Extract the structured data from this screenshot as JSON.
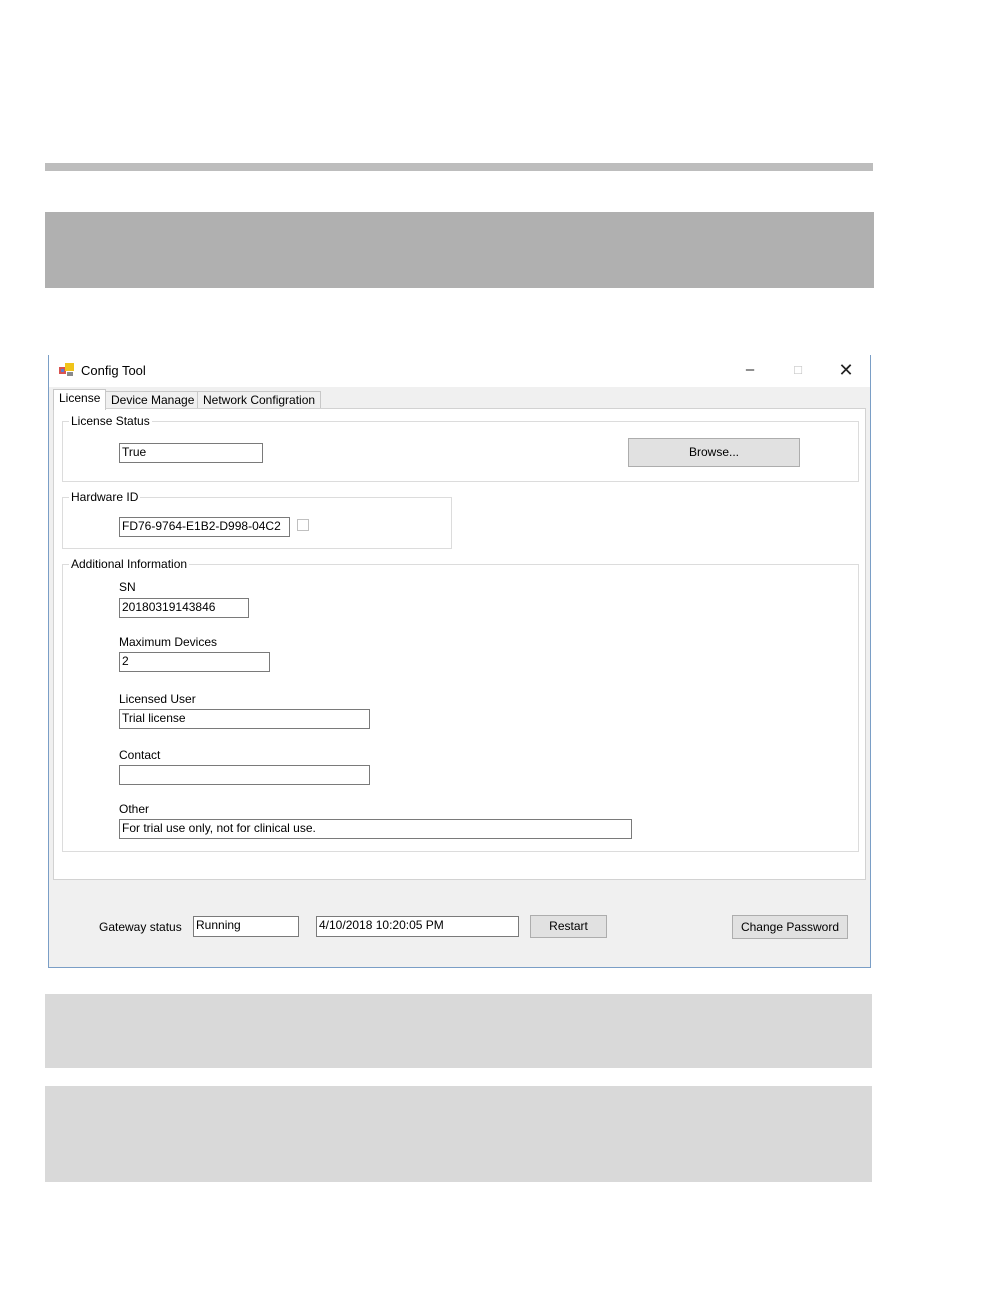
{
  "window": {
    "title": "Config Tool",
    "controls": {
      "minimize": "–",
      "maximize": "□",
      "close": "✕"
    }
  },
  "tabs": [
    {
      "label": "License",
      "active": true
    },
    {
      "label": "Device Manage",
      "active": false
    },
    {
      "label": "Network Configration",
      "active": false
    }
  ],
  "license_status": {
    "group_label": "License Status",
    "value": "True",
    "browse_label": "Browse..."
  },
  "hardware_id": {
    "group_label": "Hardware ID",
    "value": "FD76-9764-E1B2-D998-04C2"
  },
  "additional": {
    "group_label": "Additional Information",
    "sn_label": "SN",
    "sn_value": "20180319143846",
    "max_devices_label": "Maximum Devices",
    "max_devices_value": "2",
    "licensed_user_label": "Licensed User",
    "licensed_user_value": "Trial license",
    "contact_label": "Contact",
    "contact_value": "",
    "other_label": "Other",
    "other_value": "For trial use only, not for clinical use."
  },
  "gateway": {
    "label": "Gateway status",
    "status": "Running",
    "timestamp": "4/10/2018 10:20:05 PM",
    "restart_label": "Restart",
    "change_password_label": "Change Password"
  },
  "colors": {
    "window_border": "#7a9ec6",
    "gray_bar_dark": "#b0b0b0",
    "gray_bar_light": "#d9d9d9"
  }
}
